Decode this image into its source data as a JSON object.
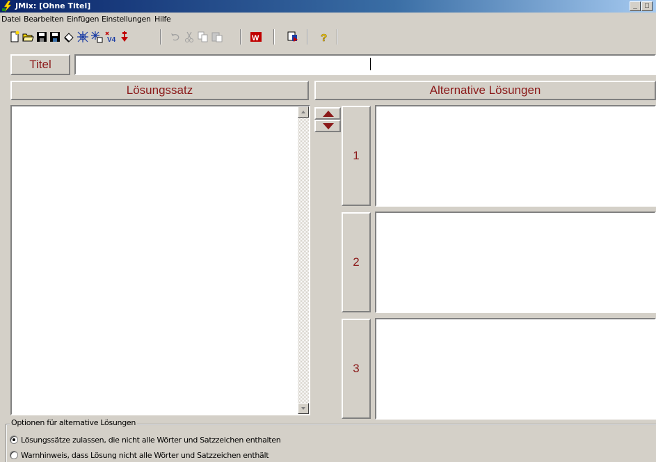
{
  "window": {
    "title": "JMix: [Ohne Titel]",
    "min_label": "_",
    "max_label": "□"
  },
  "menu": [
    "Datei",
    "Bearbeiten",
    "Einfügen",
    "Einstellungen",
    "Hilfe"
  ],
  "toolbar": {
    "icons": [
      "new-file-icon",
      "open-folder-icon",
      "save-icon",
      "save-as-icon",
      "clear-icon",
      "web-page-icon",
      "export-icon",
      "v4-icon",
      "pin-icon",
      "undo-icon",
      "cut-icon",
      "copy-icon",
      "paste-icon",
      "hot-potatoes-icon",
      "config-icon",
      "help-icon"
    ]
  },
  "titel": {
    "label": "Titel",
    "value": ""
  },
  "headers": {
    "loesungssatz": "Lösungssatz",
    "alternative": "Alternative Lösungen"
  },
  "alternatives": [
    {
      "number": "1",
      "text": ""
    },
    {
      "number": "2",
      "text": ""
    },
    {
      "number": "3",
      "text": ""
    }
  ],
  "options": {
    "legend": "Optionen für alternative Lösungen",
    "radio1": "Lösungssätze zulassen, die nicht alle Wörter und Satzzeichen enthalten",
    "radio2": "Warnhinweis, dass Lösung nicht alle Wörter und Satzzeichen enthält",
    "selected": 1
  },
  "colors": {
    "accent": "#8b1a1a",
    "face": "#d4d0c8",
    "titlebar": "#0a246a"
  }
}
